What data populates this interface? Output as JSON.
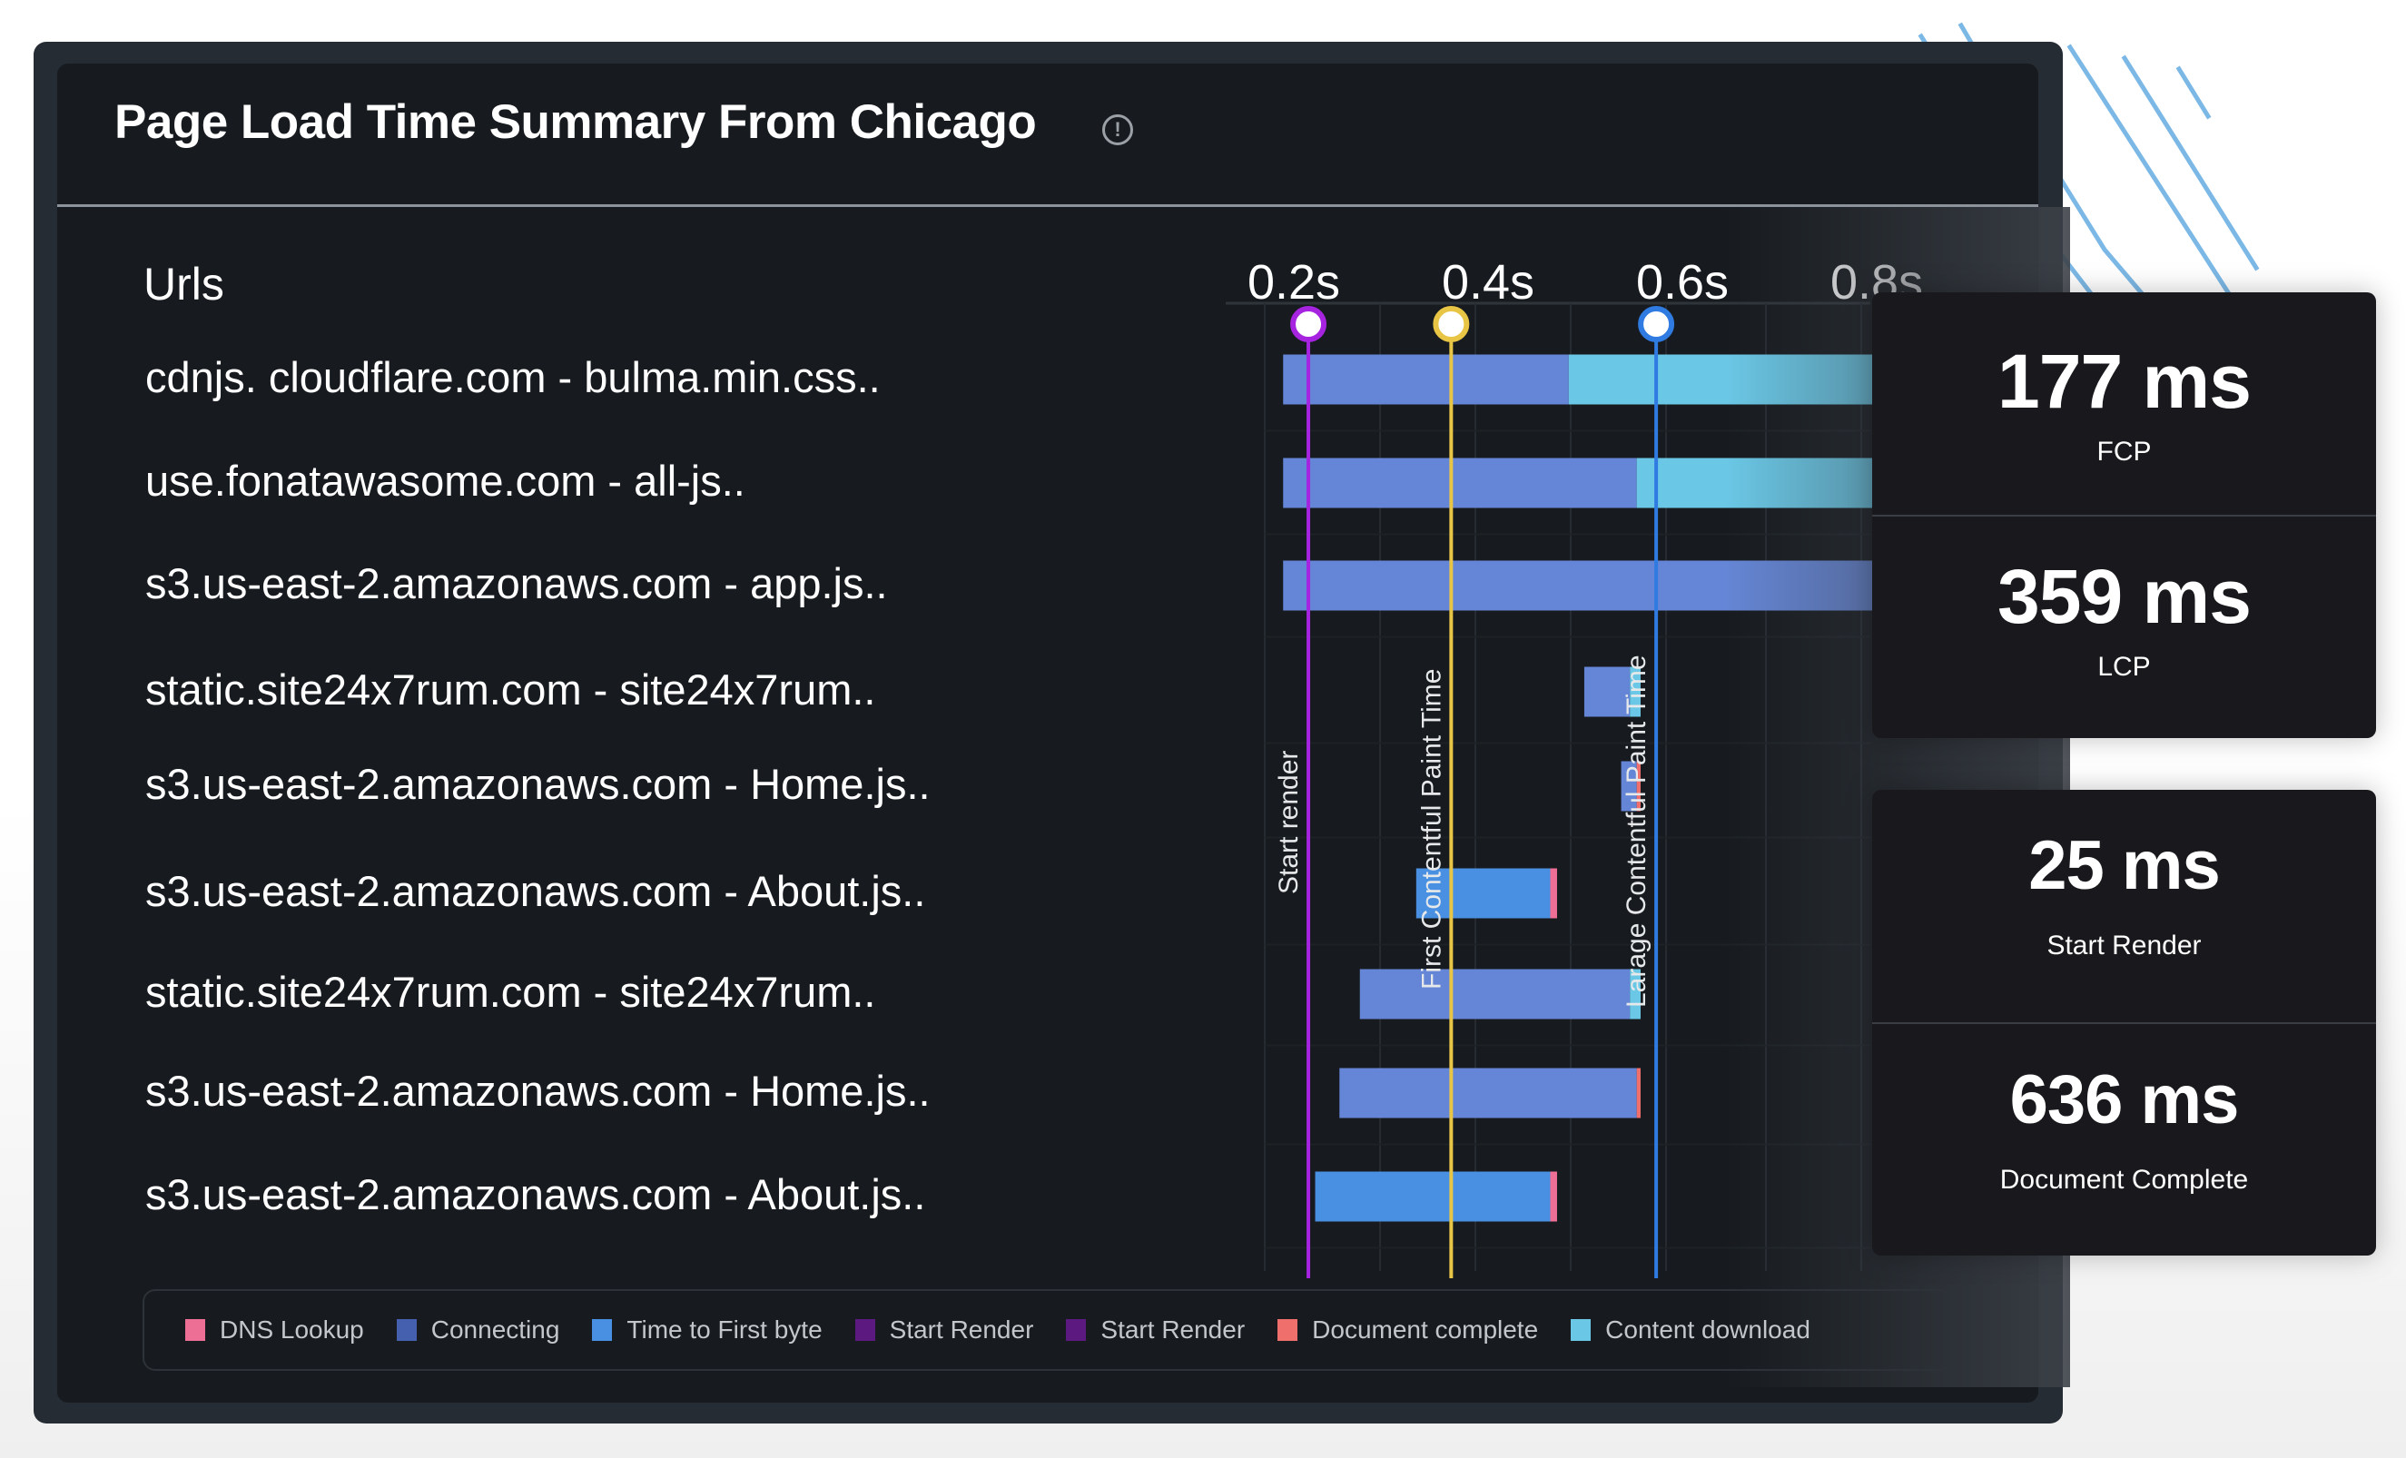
{
  "header": {
    "title": "Page Load Time Summary From Chicago",
    "info_icon": "info-circle-icon"
  },
  "table": {
    "urls_header": "Urls"
  },
  "metrics": [
    {
      "value": "177 ms",
      "label": "FCP"
    },
    {
      "value": "359 ms",
      "label": "LCP"
    },
    {
      "value": "25 ms",
      "label": "Start Render"
    },
    {
      "value": "636 ms",
      "label": "Document Complete"
    }
  ],
  "colors": {
    "dns": "#ee6f96",
    "connecting": "#4660b0",
    "ttfb": "#4a90e2",
    "start_render_1": "#5c1a80",
    "start_render_2": "#5c1a80",
    "document_complete": "#ef6f6c",
    "content_download": "#6ac8e6",
    "bar_main": "#6586d6",
    "marker_start_render": "#a624e0",
    "marker_fcp": "#e8c545",
    "marker_lcp": "#2f7be2",
    "deco_lines": "#7cb8e6"
  },
  "chart_data": {
    "type": "bar",
    "subtype": "waterfall",
    "title": "Page Load Time Summary From Chicago",
    "xlabel": "",
    "ylabel": "Urls",
    "x_unit": "s",
    "x_ticks": [
      "0.2s",
      "0.4s",
      "0.6s",
      "0.8s"
    ],
    "x_tick_values": [
      0.2,
      0.4,
      0.6,
      0.8
    ],
    "xlim_visible": [
      0.17,
      0.8
    ],
    "legend_position": "bottom",
    "legend": [
      {
        "key": "dns",
        "label": "DNS Lookup"
      },
      {
        "key": "connecting",
        "label": "Connecting"
      },
      {
        "key": "ttfb",
        "label": "Time to First byte"
      },
      {
        "key": "start_render_1",
        "label": "Start Render"
      },
      {
        "key": "start_render_2",
        "label": "Start Render"
      },
      {
        "key": "document_complete",
        "label": "Document complete"
      },
      {
        "key": "content_download",
        "label": "Content download"
      }
    ],
    "markers": [
      {
        "label": "Start render",
        "value": 0.215,
        "color_key": "marker_start_render"
      },
      {
        "label": "First Contentful Paint Time",
        "value": 0.362,
        "color_key": "marker_fcp"
      },
      {
        "label": "Larage Contentful Paint Time",
        "value": 0.573,
        "color_key": "marker_lcp"
      }
    ],
    "rows": [
      {
        "url": "cdnjs. cloudflare.com - bulma.min.css..",
        "segments": [
          {
            "type": "bar_main",
            "start": 0.189,
            "end": 0.483
          },
          {
            "type": "content_download",
            "start": 0.483,
            "end": 0.8
          }
        ]
      },
      {
        "url": "use.fonatawasome.com - all-js..",
        "segments": [
          {
            "type": "bar_main",
            "start": 0.189,
            "end": 0.553
          },
          {
            "type": "content_download",
            "start": 0.553,
            "end": 0.8
          }
        ]
      },
      {
        "url": "s3.us-east-2.amazonaws.com - app.js..",
        "segments": [
          {
            "type": "bar_main",
            "start": 0.189,
            "end": 0.8
          }
        ]
      },
      {
        "url": "static.site24x7rum.com - site24x7rum..",
        "segments": [
          {
            "type": "bar_main",
            "start": 0.499,
            "end": 0.546
          },
          {
            "type": "content_download",
            "start": 0.546,
            "end": 0.557
          }
        ]
      },
      {
        "url": "s3.us-east-2.amazonaws.com - Home.js..",
        "segments": [
          {
            "type": "bar_main",
            "start": 0.537,
            "end": 0.553
          },
          {
            "type": "document_complete",
            "start": 0.553,
            "end": 0.557
          }
        ]
      },
      {
        "url": "s3.us-east-2.amazonaws.com - About.js..",
        "segments": [
          {
            "type": "ttfb",
            "start": 0.326,
            "end": 0.464
          },
          {
            "type": "dns",
            "start": 0.464,
            "end": 0.471
          }
        ]
      },
      {
        "url": "static.site24x7rum.com - site24x7rum..",
        "segments": [
          {
            "type": "bar_main",
            "start": 0.268,
            "end": 0.546
          },
          {
            "type": "content_download",
            "start": 0.546,
            "end": 0.557
          }
        ]
      },
      {
        "url": "s3.us-east-2.amazonaws.com - Home.js..",
        "segments": [
          {
            "type": "bar_main",
            "start": 0.247,
            "end": 0.553
          },
          {
            "type": "document_complete",
            "start": 0.553,
            "end": 0.557
          }
        ]
      },
      {
        "url": "s3.us-east-2.amazonaws.com - About.js..",
        "segments": [
          {
            "type": "ttfb",
            "start": 0.222,
            "end": 0.464
          },
          {
            "type": "dns",
            "start": 0.464,
            "end": 0.471
          }
        ]
      }
    ]
  }
}
